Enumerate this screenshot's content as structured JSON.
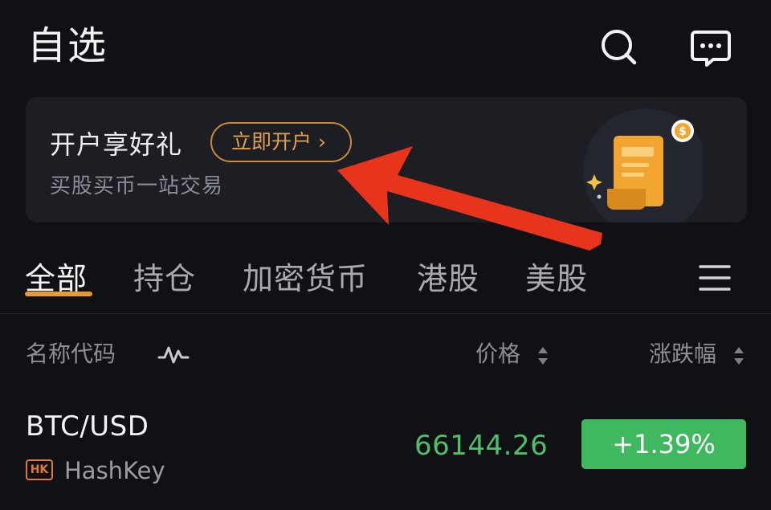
{
  "header": {
    "title": "自选",
    "icons": {
      "search": "search-icon",
      "message": "message-icon"
    }
  },
  "banner": {
    "title": "开户享好礼",
    "cta_label": "立即开户 ›",
    "subtitle": "买股买币一站交易",
    "illustration": "document-coin-illustration"
  },
  "tabs": [
    {
      "label": "全部",
      "active": true
    },
    {
      "label": "持仓",
      "active": false
    },
    {
      "label": "加密货币",
      "active": false
    },
    {
      "label": "港股",
      "active": false
    },
    {
      "label": "美股",
      "active": false
    }
  ],
  "tab_menu_icon": "hamburger-menu-icon",
  "columns": {
    "name": "名称代码",
    "price": "价格",
    "change": "涨跌幅"
  },
  "rows": [
    {
      "symbol": "BTC/USD",
      "exchange_badge": "HK",
      "exchange": "HashKey",
      "price": "66144.26",
      "change": "+1.39%"
    }
  ],
  "colors": {
    "accent": "#e89a2c",
    "up": "#3fb860",
    "cta": "#e0a050",
    "annotation": "#e8341c"
  }
}
